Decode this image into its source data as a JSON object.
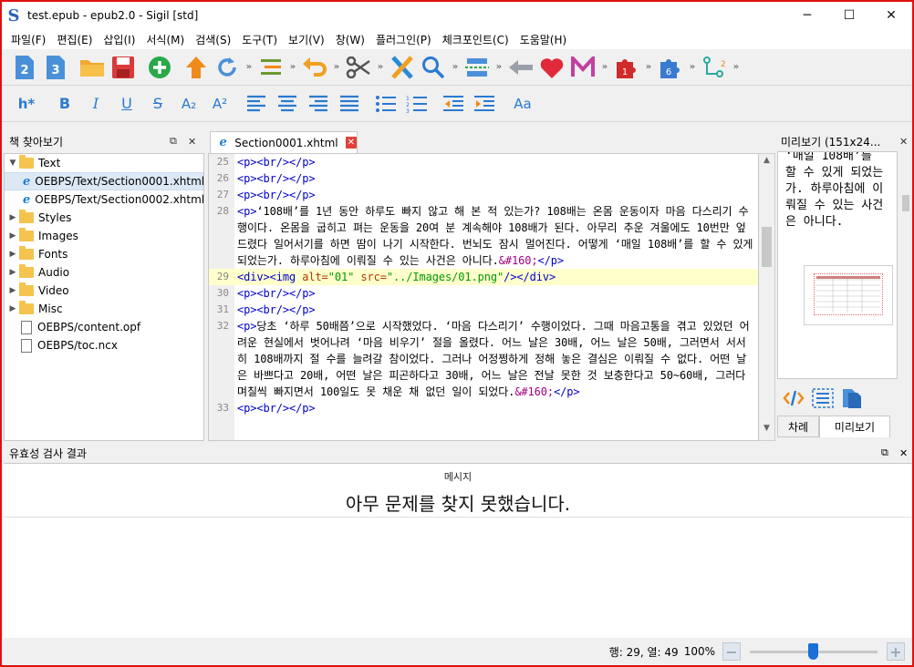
{
  "window": {
    "app_icon": "S",
    "title": "test.epub - epub2.0 - Sigil [std]",
    "minimize": "─",
    "maximize": "☐",
    "close": "✕"
  },
  "menu": [
    "파일(F)",
    "편집(E)",
    "삽입(I)",
    "서식(M)",
    "검색(S)",
    "도구(T)",
    "보기(V)",
    "창(W)",
    "플러그인(P)",
    "체크포인트(C)",
    "도움말(H)"
  ],
  "toolbar2": {
    "heading": "h*",
    "bold": "B",
    "italic": "I",
    "underline": "U",
    "strike": "S",
    "subscript": "A₂",
    "superscript": "A²",
    "case": "Aa"
  },
  "book_browser": {
    "title": "책 찾아보기",
    "items": [
      {
        "label": "Text",
        "type": "folder",
        "level": 0,
        "expanded": true
      },
      {
        "label": "OEBPS/Text/Section0001.xhtml",
        "type": "xhtml",
        "level": 1,
        "selected": true
      },
      {
        "label": "OEBPS/Text/Section0002.xhtml",
        "type": "xhtml",
        "level": 1
      },
      {
        "label": "Styles",
        "type": "folder",
        "level": 0
      },
      {
        "label": "Images",
        "type": "folder",
        "level": 0
      },
      {
        "label": "Fonts",
        "type": "folder",
        "level": 0
      },
      {
        "label": "Audio",
        "type": "folder",
        "level": 0
      },
      {
        "label": "Video",
        "type": "folder",
        "level": 0
      },
      {
        "label": "Misc",
        "type": "folder",
        "level": 0
      },
      {
        "label": "OEBPS/content.opf",
        "type": "file",
        "level": 0
      },
      {
        "label": "OEBPS/toc.ncx",
        "type": "file",
        "level": 0
      }
    ]
  },
  "editor": {
    "tab_label": "Section0001.xhtml",
    "lines": [
      {
        "num": "25",
        "html": "<span class='tag'>&lt;p&gt;&lt;br/&gt;&lt;/p&gt;</span>"
      },
      {
        "num": "26",
        "html": "<span class='tag'>&lt;p&gt;&lt;br/&gt;&lt;/p&gt;</span>"
      },
      {
        "num": "27",
        "html": "<span class='tag'>&lt;p&gt;&lt;br/&gt;&lt;/p&gt;</span>"
      },
      {
        "num": "28",
        "html": "<span class='tag'>&lt;p&gt;</span>‘108배’를 1년 동안 하루도 빠지 않고 해 본 적 있는가? 108배는 온몸 운동이자 마음 다스리기 수행이다. 온몸을 굽히고 펴는 운동을 20여 분 계속해야 108배가 된다. 아무리 추운 겨울에도 10번만 엎드렸다 일어서기를 하면 땀이 나기 시작한다. 번뇌도 잠시 멀어진다. 어떻게 ‘매일 108배’를 할 수 있게 되었는가. 하루아침에 이뤄질 수 있는 사건은 아니다.<span class='ent'>&amp;#160;</span><span class='tag'>&lt;/p&gt;</span>"
      },
      {
        "num": "29",
        "hl": true,
        "html": "<span class='tag'>&lt;div&gt;&lt;img</span> <span class='attr'>alt=</span><span class='val'>\"01\"</span> <span class='attr'>src=</span><span class='val'>\"../Images/01.png\"</span><span class='tag'>/&gt;&lt;/div&gt;</span>"
      },
      {
        "num": "30",
        "html": "<span class='tag'>&lt;p&gt;&lt;br/&gt;&lt;/p&gt;</span>"
      },
      {
        "num": "31",
        "html": "<span class='tag'>&lt;p&gt;&lt;br/&gt;&lt;/p&gt;</span>"
      },
      {
        "num": "32",
        "html": "<span class='tag'>&lt;p&gt;</span>당초 ‘하루 50배쯤’으로 시작했었다. ‘마음 다스리기’ 수행이었다. 그때 마음고통을 겪고 있었던 어려운 현실에서 벗어나려 ‘마음 비우기’ 절을 올렸다. 어느 날은 30배, 어느 날은 50배, 그러면서 서서히 108배까지 절 수를 늘려갈 참이었다. 그러나 어정쩡하게 정해 놓은 결심은 이뤄질 수 없다. 어떤 날은 바쁘다고 20배, 어떤 날은 피곤하다고 30배, 어느 날은 전날 못한 것 보충한다고 50~60배, 그러다 며칠씩 빠지면서 100일도 못 채운 채 없던 일이 되었다.<span class='ent'>&amp;#160;</span><span class='tag'>&lt;/p&gt;</span>"
      },
      {
        "num": "33",
        "html": "<span class='tag'>&lt;p&gt;&lt;br/&gt;&lt;/p&gt;</span>"
      }
    ]
  },
  "preview_panel": {
    "title": "미리보기 (151x24...",
    "text": "‘매일 108배’를 할 수 있게 되었는가. 하루아침에 이뤄질 수 있는 사건은 아니다.",
    "tabs": [
      "차례",
      "미리보기"
    ]
  },
  "validation": {
    "title": "유효성 검사 결과",
    "column_header": "메시지",
    "message": "아무 문제를 찾지 못했습니다."
  },
  "status": {
    "position": "행: 29, 열: 49",
    "zoom": "100%",
    "zoom_level": 0.5
  },
  "colors": {
    "frame_border": "#e01010",
    "accent_blue": "#1a6fd8",
    "tag_blue": "#0000c8"
  }
}
